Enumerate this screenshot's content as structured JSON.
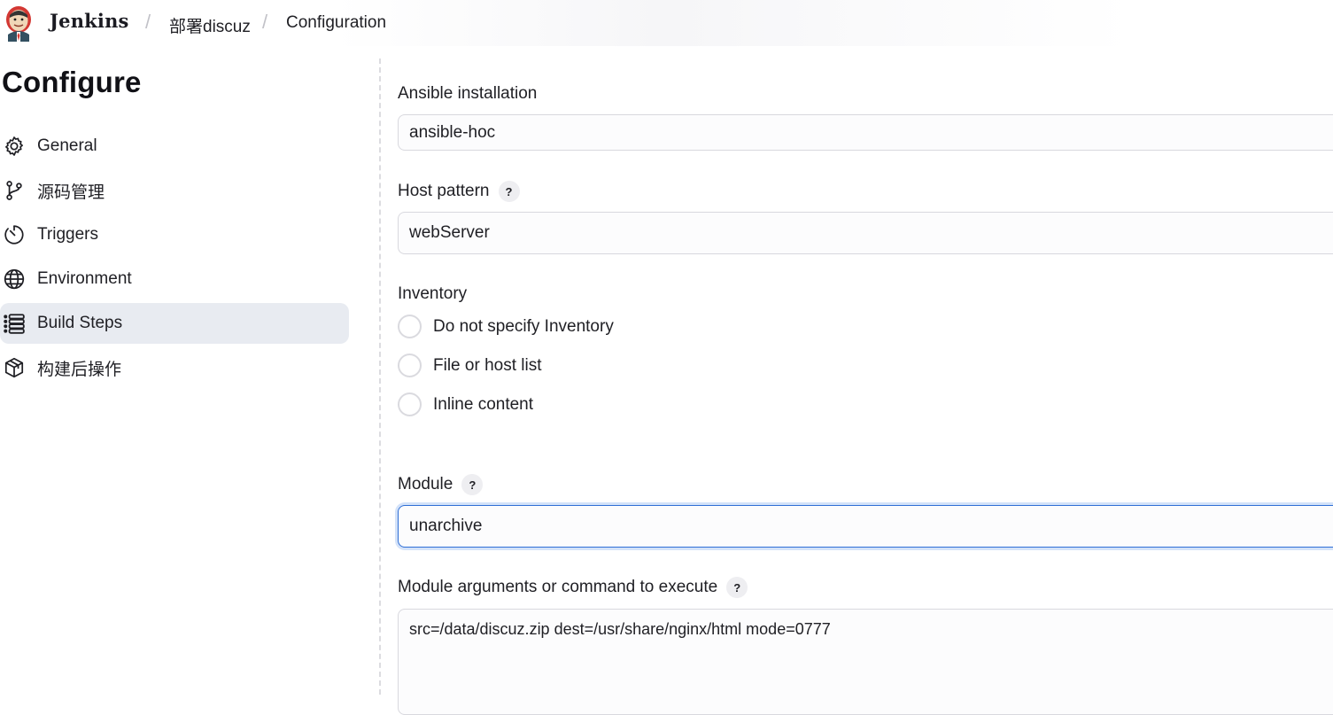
{
  "header": {
    "brand": "Jenkins",
    "breadcrumbs": [
      "部署discuz",
      "Configuration"
    ]
  },
  "sidebar": {
    "title": "Configure",
    "items": [
      {
        "label": "General",
        "icon": "gear-icon"
      },
      {
        "label": "源码管理",
        "icon": "branch-icon"
      },
      {
        "label": "Triggers",
        "icon": "timer-icon"
      },
      {
        "label": "Environment",
        "icon": "globe-icon"
      },
      {
        "label": "Build Steps",
        "icon": "list-icon",
        "active": true
      },
      {
        "label": "构建后操作",
        "icon": "package-icon"
      }
    ]
  },
  "form": {
    "ansible_installation": {
      "label": "Ansible installation",
      "value": "ansible-hoc"
    },
    "host_pattern": {
      "label": "Host pattern",
      "value": "webServer"
    },
    "inventory": {
      "label": "Inventory",
      "options": [
        "Do not specify Inventory",
        "File or host list",
        "Inline content"
      ]
    },
    "module": {
      "label": "Module",
      "value": "unarchive"
    },
    "module_args": {
      "label": "Module arguments or command to execute",
      "value": "src=/data/discuz.zip dest=/usr/share/nginx/html mode=0777"
    },
    "help_glyph": "?"
  },
  "colors": {
    "active_bg": "#e8ebf1",
    "focus_border": "#2f6fd6"
  }
}
